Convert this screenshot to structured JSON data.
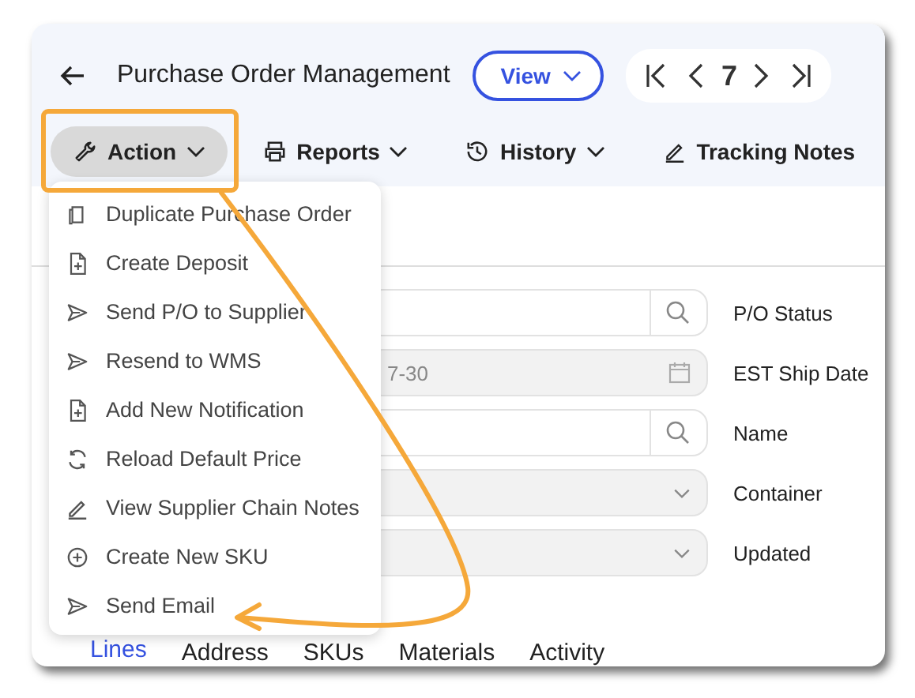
{
  "header": {
    "title": "Purchase Order Management",
    "view_button": "View",
    "pager": {
      "current": "7"
    }
  },
  "toolbar": [
    {
      "label": "Action",
      "dropdown": true,
      "selected": true
    },
    {
      "label": "Reports",
      "dropdown": true,
      "selected": false
    },
    {
      "label": "History",
      "dropdown": true,
      "selected": false
    },
    {
      "label": "Tracking Notes",
      "dropdown": false,
      "selected": false
    }
  ],
  "action_menu": [
    {
      "label": "Duplicate Purchase Order"
    },
    {
      "label": "Create Deposit"
    },
    {
      "label": "Send P/O to Supplier"
    },
    {
      "label": "Resend to WMS"
    },
    {
      "label": "Add New Notification"
    },
    {
      "label": "Reload Default Price"
    },
    {
      "label": "View Supplier Chain Notes"
    },
    {
      "label": "Create New SKU"
    },
    {
      "label": "Send Email"
    }
  ],
  "fields": [
    {
      "kind": "search",
      "label": "P/O Status"
    },
    {
      "kind": "date",
      "value": "7-30",
      "label": "EST Ship Date"
    },
    {
      "kind": "search",
      "label": "Name"
    },
    {
      "kind": "select",
      "label": "Container"
    },
    {
      "kind": "select",
      "label": "Updated"
    }
  ],
  "tabs": [
    {
      "label": "Lines",
      "selected": true
    },
    {
      "label": "Address",
      "selected": false
    },
    {
      "label": "SKUs",
      "selected": false
    },
    {
      "label": "Materials",
      "selected": false
    },
    {
      "label": "Activity",
      "selected": false
    }
  ]
}
